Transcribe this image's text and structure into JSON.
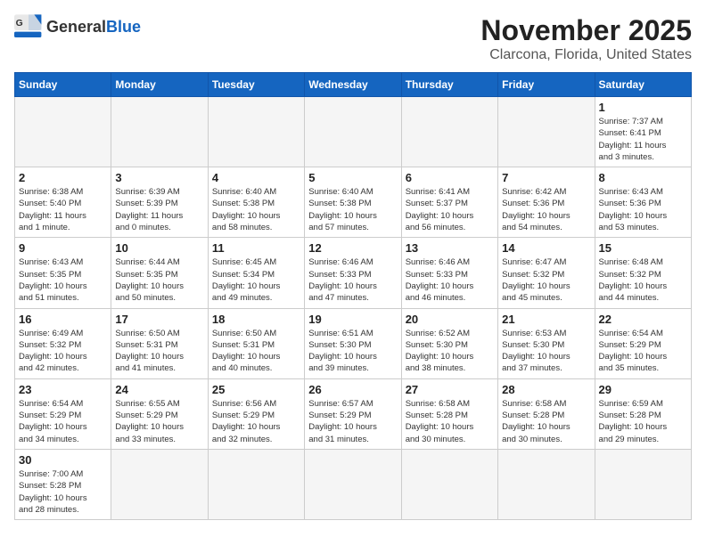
{
  "header": {
    "logo_general": "General",
    "logo_blue": "Blue",
    "month": "November 2025",
    "location": "Clarcona, Florida, United States"
  },
  "weekdays": [
    "Sunday",
    "Monday",
    "Tuesday",
    "Wednesday",
    "Thursday",
    "Friday",
    "Saturday"
  ],
  "weeks": [
    [
      {
        "day": "",
        "info": ""
      },
      {
        "day": "",
        "info": ""
      },
      {
        "day": "",
        "info": ""
      },
      {
        "day": "",
        "info": ""
      },
      {
        "day": "",
        "info": ""
      },
      {
        "day": "",
        "info": ""
      },
      {
        "day": "1",
        "info": "Sunrise: 7:37 AM\nSunset: 6:41 PM\nDaylight: 11 hours\nand 3 minutes."
      }
    ],
    [
      {
        "day": "2",
        "info": "Sunrise: 6:38 AM\nSunset: 5:40 PM\nDaylight: 11 hours\nand 1 minute."
      },
      {
        "day": "3",
        "info": "Sunrise: 6:39 AM\nSunset: 5:39 PM\nDaylight: 11 hours\nand 0 minutes."
      },
      {
        "day": "4",
        "info": "Sunrise: 6:40 AM\nSunset: 5:38 PM\nDaylight: 10 hours\nand 58 minutes."
      },
      {
        "day": "5",
        "info": "Sunrise: 6:40 AM\nSunset: 5:38 PM\nDaylight: 10 hours\nand 57 minutes."
      },
      {
        "day": "6",
        "info": "Sunrise: 6:41 AM\nSunset: 5:37 PM\nDaylight: 10 hours\nand 56 minutes."
      },
      {
        "day": "7",
        "info": "Sunrise: 6:42 AM\nSunset: 5:36 PM\nDaylight: 10 hours\nand 54 minutes."
      },
      {
        "day": "8",
        "info": "Sunrise: 6:43 AM\nSunset: 5:36 PM\nDaylight: 10 hours\nand 53 minutes."
      }
    ],
    [
      {
        "day": "9",
        "info": "Sunrise: 6:43 AM\nSunset: 5:35 PM\nDaylight: 10 hours\nand 51 minutes."
      },
      {
        "day": "10",
        "info": "Sunrise: 6:44 AM\nSunset: 5:35 PM\nDaylight: 10 hours\nand 50 minutes."
      },
      {
        "day": "11",
        "info": "Sunrise: 6:45 AM\nSunset: 5:34 PM\nDaylight: 10 hours\nand 49 minutes."
      },
      {
        "day": "12",
        "info": "Sunrise: 6:46 AM\nSunset: 5:33 PM\nDaylight: 10 hours\nand 47 minutes."
      },
      {
        "day": "13",
        "info": "Sunrise: 6:46 AM\nSunset: 5:33 PM\nDaylight: 10 hours\nand 46 minutes."
      },
      {
        "day": "14",
        "info": "Sunrise: 6:47 AM\nSunset: 5:32 PM\nDaylight: 10 hours\nand 45 minutes."
      },
      {
        "day": "15",
        "info": "Sunrise: 6:48 AM\nSunset: 5:32 PM\nDaylight: 10 hours\nand 44 minutes."
      }
    ],
    [
      {
        "day": "16",
        "info": "Sunrise: 6:49 AM\nSunset: 5:32 PM\nDaylight: 10 hours\nand 42 minutes."
      },
      {
        "day": "17",
        "info": "Sunrise: 6:50 AM\nSunset: 5:31 PM\nDaylight: 10 hours\nand 41 minutes."
      },
      {
        "day": "18",
        "info": "Sunrise: 6:50 AM\nSunset: 5:31 PM\nDaylight: 10 hours\nand 40 minutes."
      },
      {
        "day": "19",
        "info": "Sunrise: 6:51 AM\nSunset: 5:30 PM\nDaylight: 10 hours\nand 39 minutes."
      },
      {
        "day": "20",
        "info": "Sunrise: 6:52 AM\nSunset: 5:30 PM\nDaylight: 10 hours\nand 38 minutes."
      },
      {
        "day": "21",
        "info": "Sunrise: 6:53 AM\nSunset: 5:30 PM\nDaylight: 10 hours\nand 37 minutes."
      },
      {
        "day": "22",
        "info": "Sunrise: 6:54 AM\nSunset: 5:29 PM\nDaylight: 10 hours\nand 35 minutes."
      }
    ],
    [
      {
        "day": "23",
        "info": "Sunrise: 6:54 AM\nSunset: 5:29 PM\nDaylight: 10 hours\nand 34 minutes."
      },
      {
        "day": "24",
        "info": "Sunrise: 6:55 AM\nSunset: 5:29 PM\nDaylight: 10 hours\nand 33 minutes."
      },
      {
        "day": "25",
        "info": "Sunrise: 6:56 AM\nSunset: 5:29 PM\nDaylight: 10 hours\nand 32 minutes."
      },
      {
        "day": "26",
        "info": "Sunrise: 6:57 AM\nSunset: 5:29 PM\nDaylight: 10 hours\nand 31 minutes."
      },
      {
        "day": "27",
        "info": "Sunrise: 6:58 AM\nSunset: 5:28 PM\nDaylight: 10 hours\nand 30 minutes."
      },
      {
        "day": "28",
        "info": "Sunrise: 6:58 AM\nSunset: 5:28 PM\nDaylight: 10 hours\nand 30 minutes."
      },
      {
        "day": "29",
        "info": "Sunrise: 6:59 AM\nSunset: 5:28 PM\nDaylight: 10 hours\nand 29 minutes."
      }
    ],
    [
      {
        "day": "30",
        "info": "Sunrise: 7:00 AM\nSunset: 5:28 PM\nDaylight: 10 hours\nand 28 minutes."
      },
      {
        "day": "",
        "info": ""
      },
      {
        "day": "",
        "info": ""
      },
      {
        "day": "",
        "info": ""
      },
      {
        "day": "",
        "info": ""
      },
      {
        "day": "",
        "info": ""
      },
      {
        "day": "",
        "info": ""
      }
    ]
  ]
}
